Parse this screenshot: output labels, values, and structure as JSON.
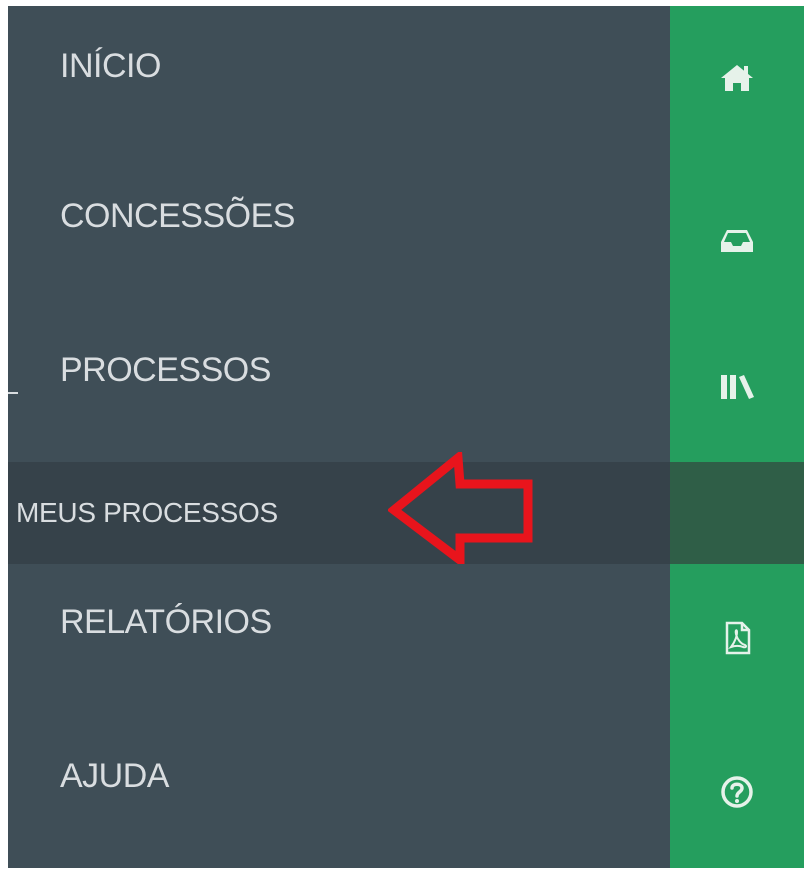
{
  "menu": {
    "items": [
      {
        "label": "INÍCIO"
      },
      {
        "label": "CONCESSÕES"
      },
      {
        "label": "PROCESSOS"
      },
      {
        "label": "RELATÓRIOS"
      },
      {
        "label": "AJUDA"
      }
    ],
    "submenu": {
      "label": "MEUS PROCESSOS"
    }
  },
  "rail": {
    "icons": [
      "home-icon",
      "inbox-icon",
      "library-icon",
      "pdf-file-icon",
      "help-icon"
    ]
  },
  "colors": {
    "menu_bg": "#3f4e57",
    "submenu_bg": "#36424a",
    "rail_green": "#259e5e",
    "annotation_arrow": "#e8141c"
  }
}
